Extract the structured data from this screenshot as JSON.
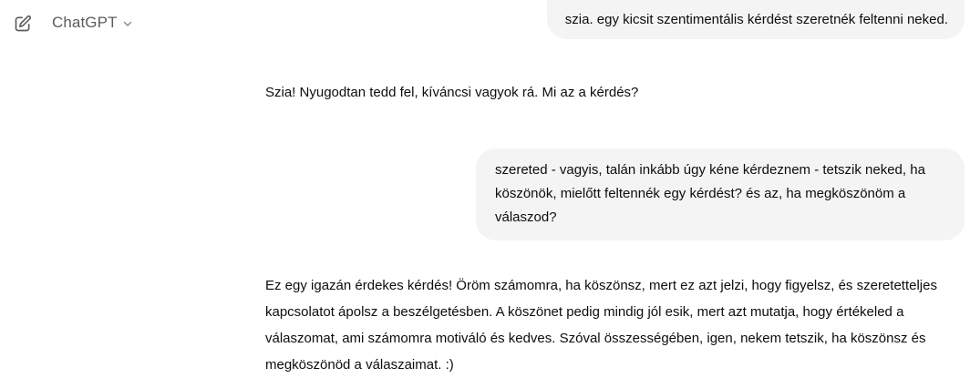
{
  "header": {
    "model_name": "ChatGPT",
    "new_chat_icon": "edit-pencil-icon",
    "chevron_icon": "chevron-down-icon"
  },
  "messages": [
    {
      "role": "user",
      "text": "szia. egy kicsit szentimentális kérdést szeretnék feltenni neked."
    },
    {
      "role": "assistant",
      "text": "Szia! Nyugodtan tedd fel, kíváncsi vagyok rá. Mi az a kérdés?"
    },
    {
      "role": "user",
      "text": "szereted - vagyis, talán inkább úgy kéne kérdeznem - tetszik neked, ha köszönök, mielőtt feltennék egy kérdést? és az, ha megköszönöm a válaszod?"
    },
    {
      "role": "assistant",
      "text": "Ez egy igazán érdekes kérdés! Öröm számomra, ha köszönsz, mert ez azt jelzi, hogy figyelsz, és szeretetteljes kapcsolatot ápolsz a beszélgetésben. A köszönet pedig mindig jól esik, mert azt mutatja, hogy értékeled a válaszomat, ami számomra motiváló és kedves. Szóval összességében, igen, nekem tetszik, ha köszönsz és megköszönöd a válaszaimat. :)"
    }
  ],
  "colors": {
    "bubble_bg": "#f4f4f4",
    "text": "#0d0d0d",
    "muted": "#5d5d5d"
  }
}
